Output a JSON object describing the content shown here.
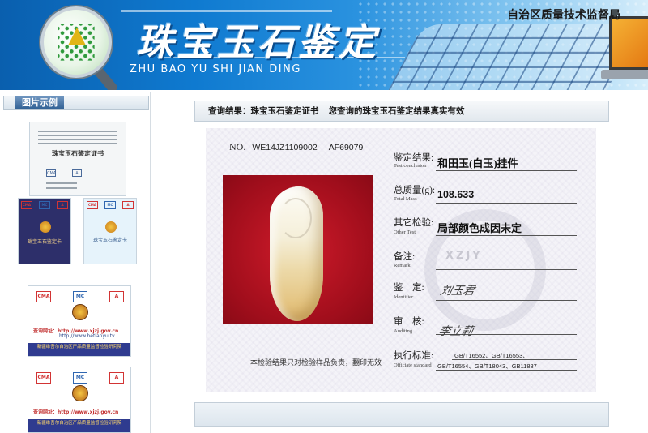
{
  "header": {
    "title_cn": "珠宝玉石鉴定",
    "title_en": "ZHU BAO YU SHI JIAN DING",
    "bureau": "自治区质量技术监督局"
  },
  "sidebar": {
    "heading": "图片示例",
    "cert_title": "珠宝玉石鉴定证书",
    "card_dark_text": "珠宝玉石鉴定卡",
    "card_light_text": "珠宝玉石鉴定卡",
    "badge_url_label": "查询网址：",
    "badge1_url1": "http://www.xjzj.gov.cn",
    "badge1_url2": "http://www.hetianyu.tv",
    "badge2_url1": "http://www.xjzj.gov.cn",
    "stripe_text": "新疆维吾尔自治区产品质量监督检验研究院"
  },
  "result": {
    "label": "查询结果：珠宝玉石鉴定证书",
    "message": "您查询的珠宝玉石鉴定结果真实有效"
  },
  "certificate": {
    "no_label": "NO.",
    "no_value": "WE14JZ1109002",
    "no_value2": "AF69079",
    "watermark": "XZJY",
    "conclusion_cn": "鉴定结果:",
    "conclusion_en": "Test conclusion",
    "conclusion_value": "和田玉(白玉)挂件",
    "mass_cn": "总质量(g):",
    "mass_en": "Total Mass",
    "mass_value": "108.633",
    "other_cn": "其它检验:",
    "other_en": "Other Test",
    "other_value": "局部颜色成因未定",
    "remark_cn": "备注:",
    "remark_en": "Remark",
    "identifier_cn": "鉴    定:",
    "identifier_en": "Identifier",
    "identifier_sig": "刘玉君",
    "auditing_cn": "审    核:",
    "auditing_en": "Auditing",
    "auditing_sig": "李立莉",
    "standard_cn": "执行标准:",
    "standard_en": "Officiate standard",
    "standard_line1": "GB/T16552、GB/T16553、",
    "standard_line2": "GB/T16554、GB/T18043、GB11887",
    "disclaimer": "本检验结果只对检验样品负责，翻印无效"
  },
  "colors": {
    "banner": "#0f7ad0",
    "jade_backdrop": "#a10e1c",
    "sidebar_tab": "#2f5f93"
  }
}
